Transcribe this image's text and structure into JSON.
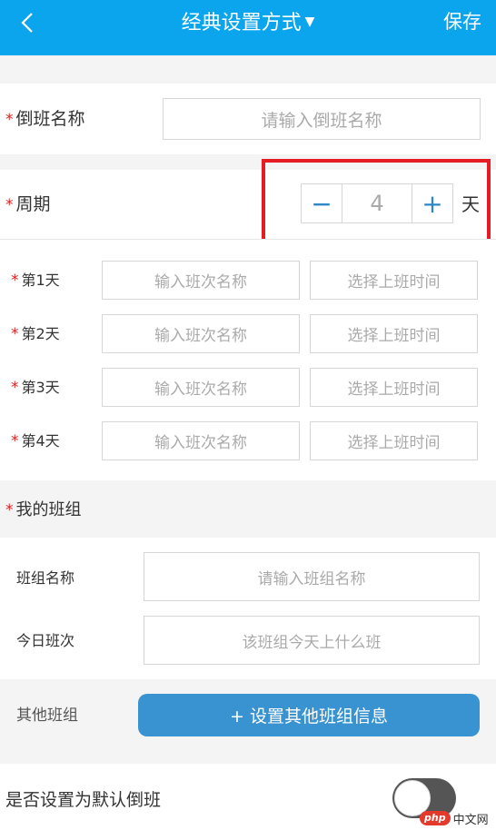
{
  "header": {
    "title": "经典设置方式",
    "title_caret": "▼",
    "save_label": "保存"
  },
  "form": {
    "required_mark": "*",
    "shift_name": {
      "label": "倒班名称",
      "placeholder": "请输入倒班名称"
    },
    "cycle": {
      "label": "周期",
      "value": "4",
      "minus": "−",
      "plus": "+",
      "unit": "天"
    },
    "days": [
      {
        "label": "第1天",
        "name_placeholder": "输入班次名称",
        "time_placeholder": "选择上班时间"
      },
      {
        "label": "第2天",
        "name_placeholder": "输入班次名称",
        "time_placeholder": "选择上班时间"
      },
      {
        "label": "第3天",
        "name_placeholder": "输入班次名称",
        "time_placeholder": "选择上班时间"
      },
      {
        "label": "第4天",
        "name_placeholder": "输入班次名称",
        "time_placeholder": "选择上班时间"
      }
    ],
    "my_group": {
      "section_label": "我的班组",
      "group_name": {
        "label": "班组名称",
        "placeholder": "请输入班组名称"
      },
      "today_shift": {
        "label": "今日班次",
        "placeholder": "该班组今天上什么班"
      }
    },
    "other_groups": {
      "label": "其他班组",
      "button": "+ 设置其他班组信息"
    },
    "default_shift": {
      "label": "是否设置为默认倒班",
      "enabled": false
    }
  },
  "watermark": {
    "logo": "php",
    "text": "中文网"
  },
  "colors": {
    "accent": "#0aa5ec",
    "button": "#3a93d1",
    "required": "#e02020",
    "highlight": "#e51c23"
  }
}
